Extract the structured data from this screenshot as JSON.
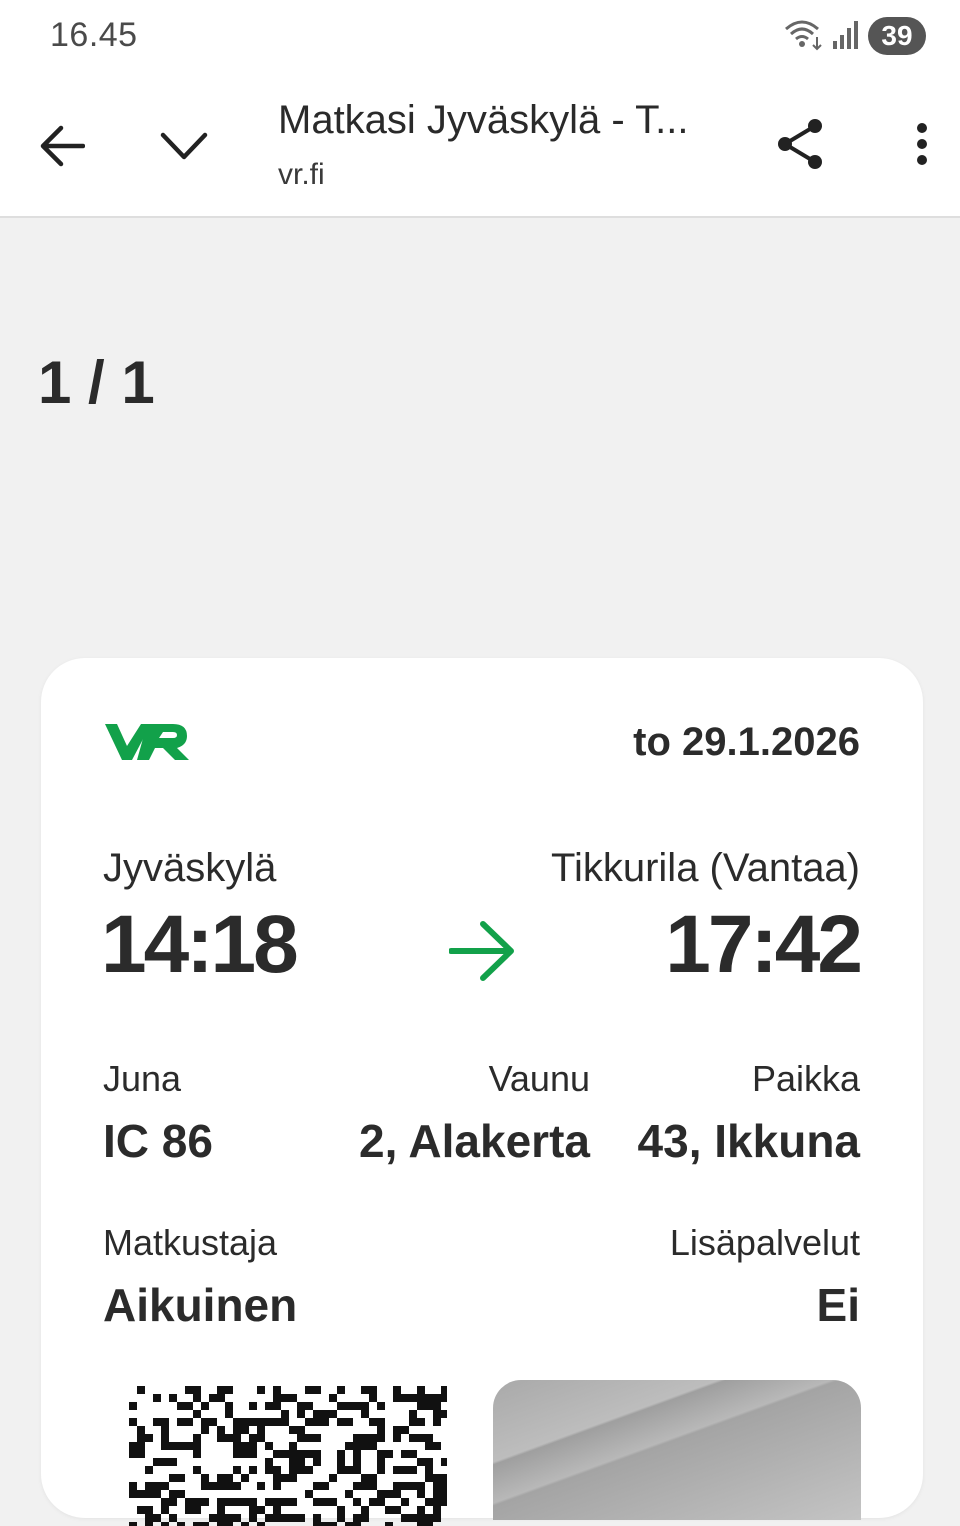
{
  "status_bar": {
    "time": "16.45",
    "battery": "39",
    "icons": [
      "wifi-icon",
      "signal-icon",
      "battery-icon"
    ]
  },
  "toolbar": {
    "title": "Matkasi Jyväskylä - T...",
    "subtitle": "vr.fi",
    "icons": [
      "back-arrow-icon",
      "chevron-down-icon",
      "share-icon",
      "more-vert-icon"
    ]
  },
  "page_counter": "1 / 1",
  "ticket": {
    "date": "to 29.1.2026",
    "brand_color": "#12a14a",
    "from_station": "Jyväskylä",
    "departure_time": "14:18",
    "to_station": "Tikkurila (Vantaa)",
    "arrival_time": "17:42",
    "train_label": "Juna",
    "train_value": "IC 86",
    "car_label": "Vaunu",
    "car_value": "2, Alakerta",
    "seat_label": "Paikka",
    "seat_value": "43, Ikkuna",
    "passenger_label": "Matkustaja",
    "passenger_value": "Aikuinen",
    "extras_label": "Lisäpalvelut",
    "extras_value": "Ei"
  }
}
